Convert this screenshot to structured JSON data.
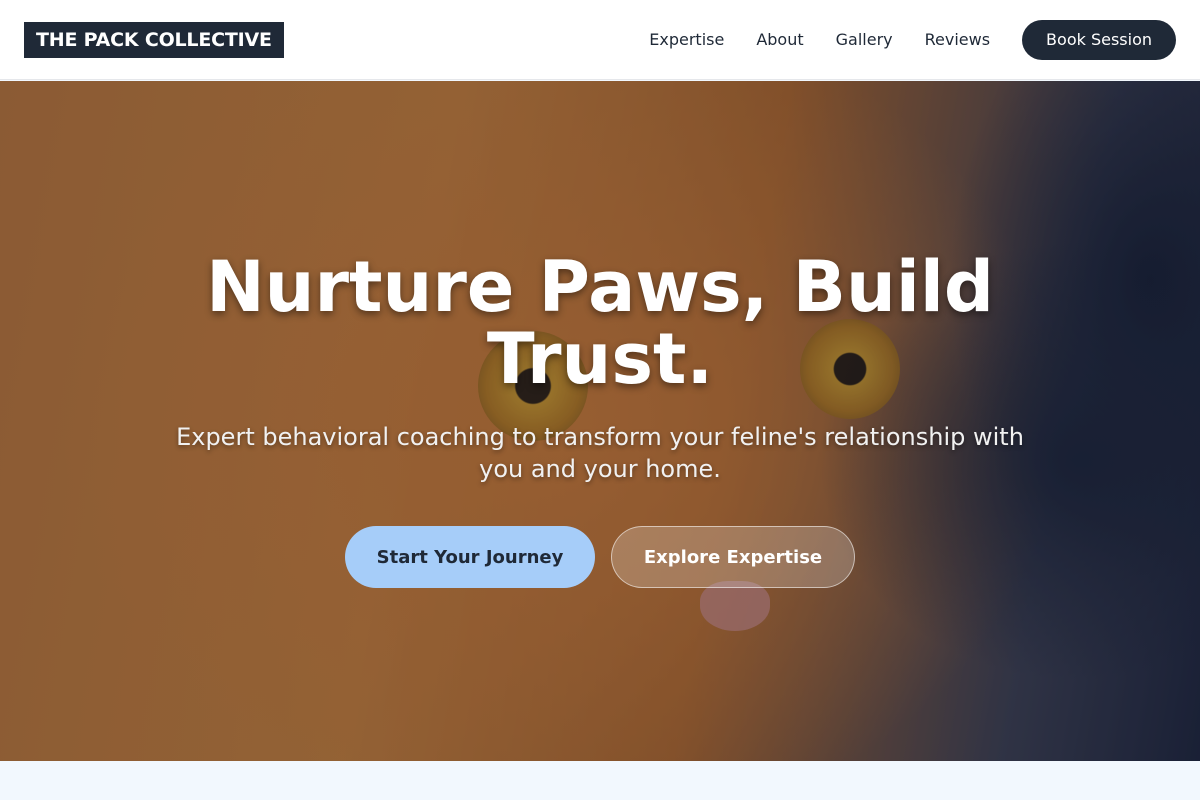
{
  "header": {
    "logo": "THE PACK COLLECTIVE",
    "nav": [
      {
        "label": "Expertise"
      },
      {
        "label": "About"
      },
      {
        "label": "Gallery"
      },
      {
        "label": "Reviews"
      }
    ],
    "cta_label": "Book Session"
  },
  "hero": {
    "title": "Nurture Paws, Build Trust.",
    "subtitle": "Expert behavioral coaching to transform your feline's relationship with you and your home.",
    "primary_label": "Start Your Journey",
    "secondary_label": "Explore Expertise",
    "background_subject": "orange-tabby-cat-photo"
  },
  "colors": {
    "brand_dark": "#1f2937",
    "primary_button": "#a6cdf9",
    "header_bg": "#ffffff",
    "section_bg": "#f2f8fe"
  }
}
